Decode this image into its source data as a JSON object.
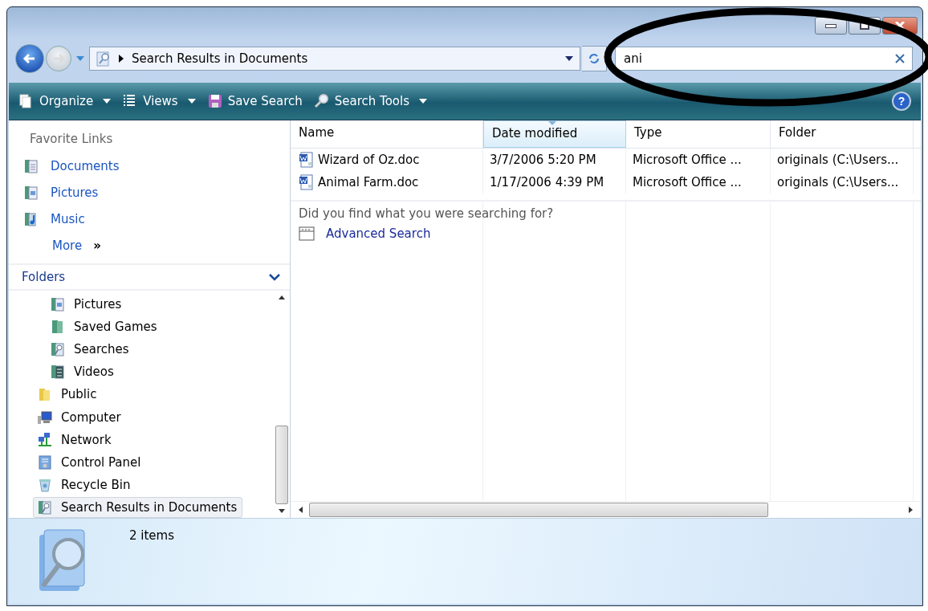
{
  "address_bar": {
    "path": "Search Results in Documents"
  },
  "search": {
    "value": "ani"
  },
  "toolbar": [
    {
      "label": "Organize",
      "kind": "pages",
      "dropdown": true
    },
    {
      "label": "Views",
      "kind": "views",
      "dropdown": true
    },
    {
      "label": "Save Search",
      "kind": "disk",
      "dropdown": false
    },
    {
      "label": "Search Tools",
      "kind": "search",
      "dropdown": true
    }
  ],
  "help": "?",
  "favorite_links": {
    "title": "Favorite Links",
    "items": [
      {
        "label": "Documents",
        "kind": "documents"
      },
      {
        "label": "Pictures",
        "kind": "pictures"
      },
      {
        "label": "Music",
        "kind": "music"
      }
    ],
    "more": "More",
    "more_glyph": "»"
  },
  "folders": {
    "title": "Folders",
    "expanded": true,
    "tree": [
      {
        "children": [
          {
            "label": "Pictures",
            "kind": "pictures",
            "selected": false
          },
          {
            "label": "Saved Games",
            "kind": "library",
            "selected": false
          },
          {
            "label": "Searches",
            "kind": "searches",
            "selected": false
          },
          {
            "label": "Videos",
            "kind": "videos",
            "selected": false
          }
        ]
      },
      {
        "label": "Public",
        "kind": "folder",
        "selected": false
      },
      {
        "label": "Computer",
        "kind": "computer",
        "selected": false
      },
      {
        "label": "Network",
        "kind": "network",
        "selected": false
      },
      {
        "label": "Control Panel",
        "kind": "control",
        "selected": false
      },
      {
        "label": "Recycle Bin",
        "kind": "bin",
        "selected": false
      },
      {
        "label": "Search Results in Documents",
        "kind": "searches",
        "selected": true
      }
    ]
  },
  "table": {
    "columns": [
      {
        "label": "Name",
        "sorted": false
      },
      {
        "label": "Date modified",
        "sorted": true
      },
      {
        "label": "Type",
        "sorted": false
      },
      {
        "label": "Folder",
        "sorted": false
      }
    ],
    "rows": [
      {
        "cells": [
          "Wizard of Oz.doc",
          "3/7/2006 5:20 PM",
          "Microsoft Office ...",
          "originals (C:\\Users..."
        ]
      },
      {
        "cells": [
          "Animal Farm.doc",
          "1/17/2006 4:39 PM",
          "Microsoft Office ...",
          "originals (C:\\Users..."
        ]
      }
    ]
  },
  "search_prompt": "Did you find what you were searching for?",
  "advanced_search": "Advanced Search",
  "status_bar": {
    "count": "2 items"
  }
}
